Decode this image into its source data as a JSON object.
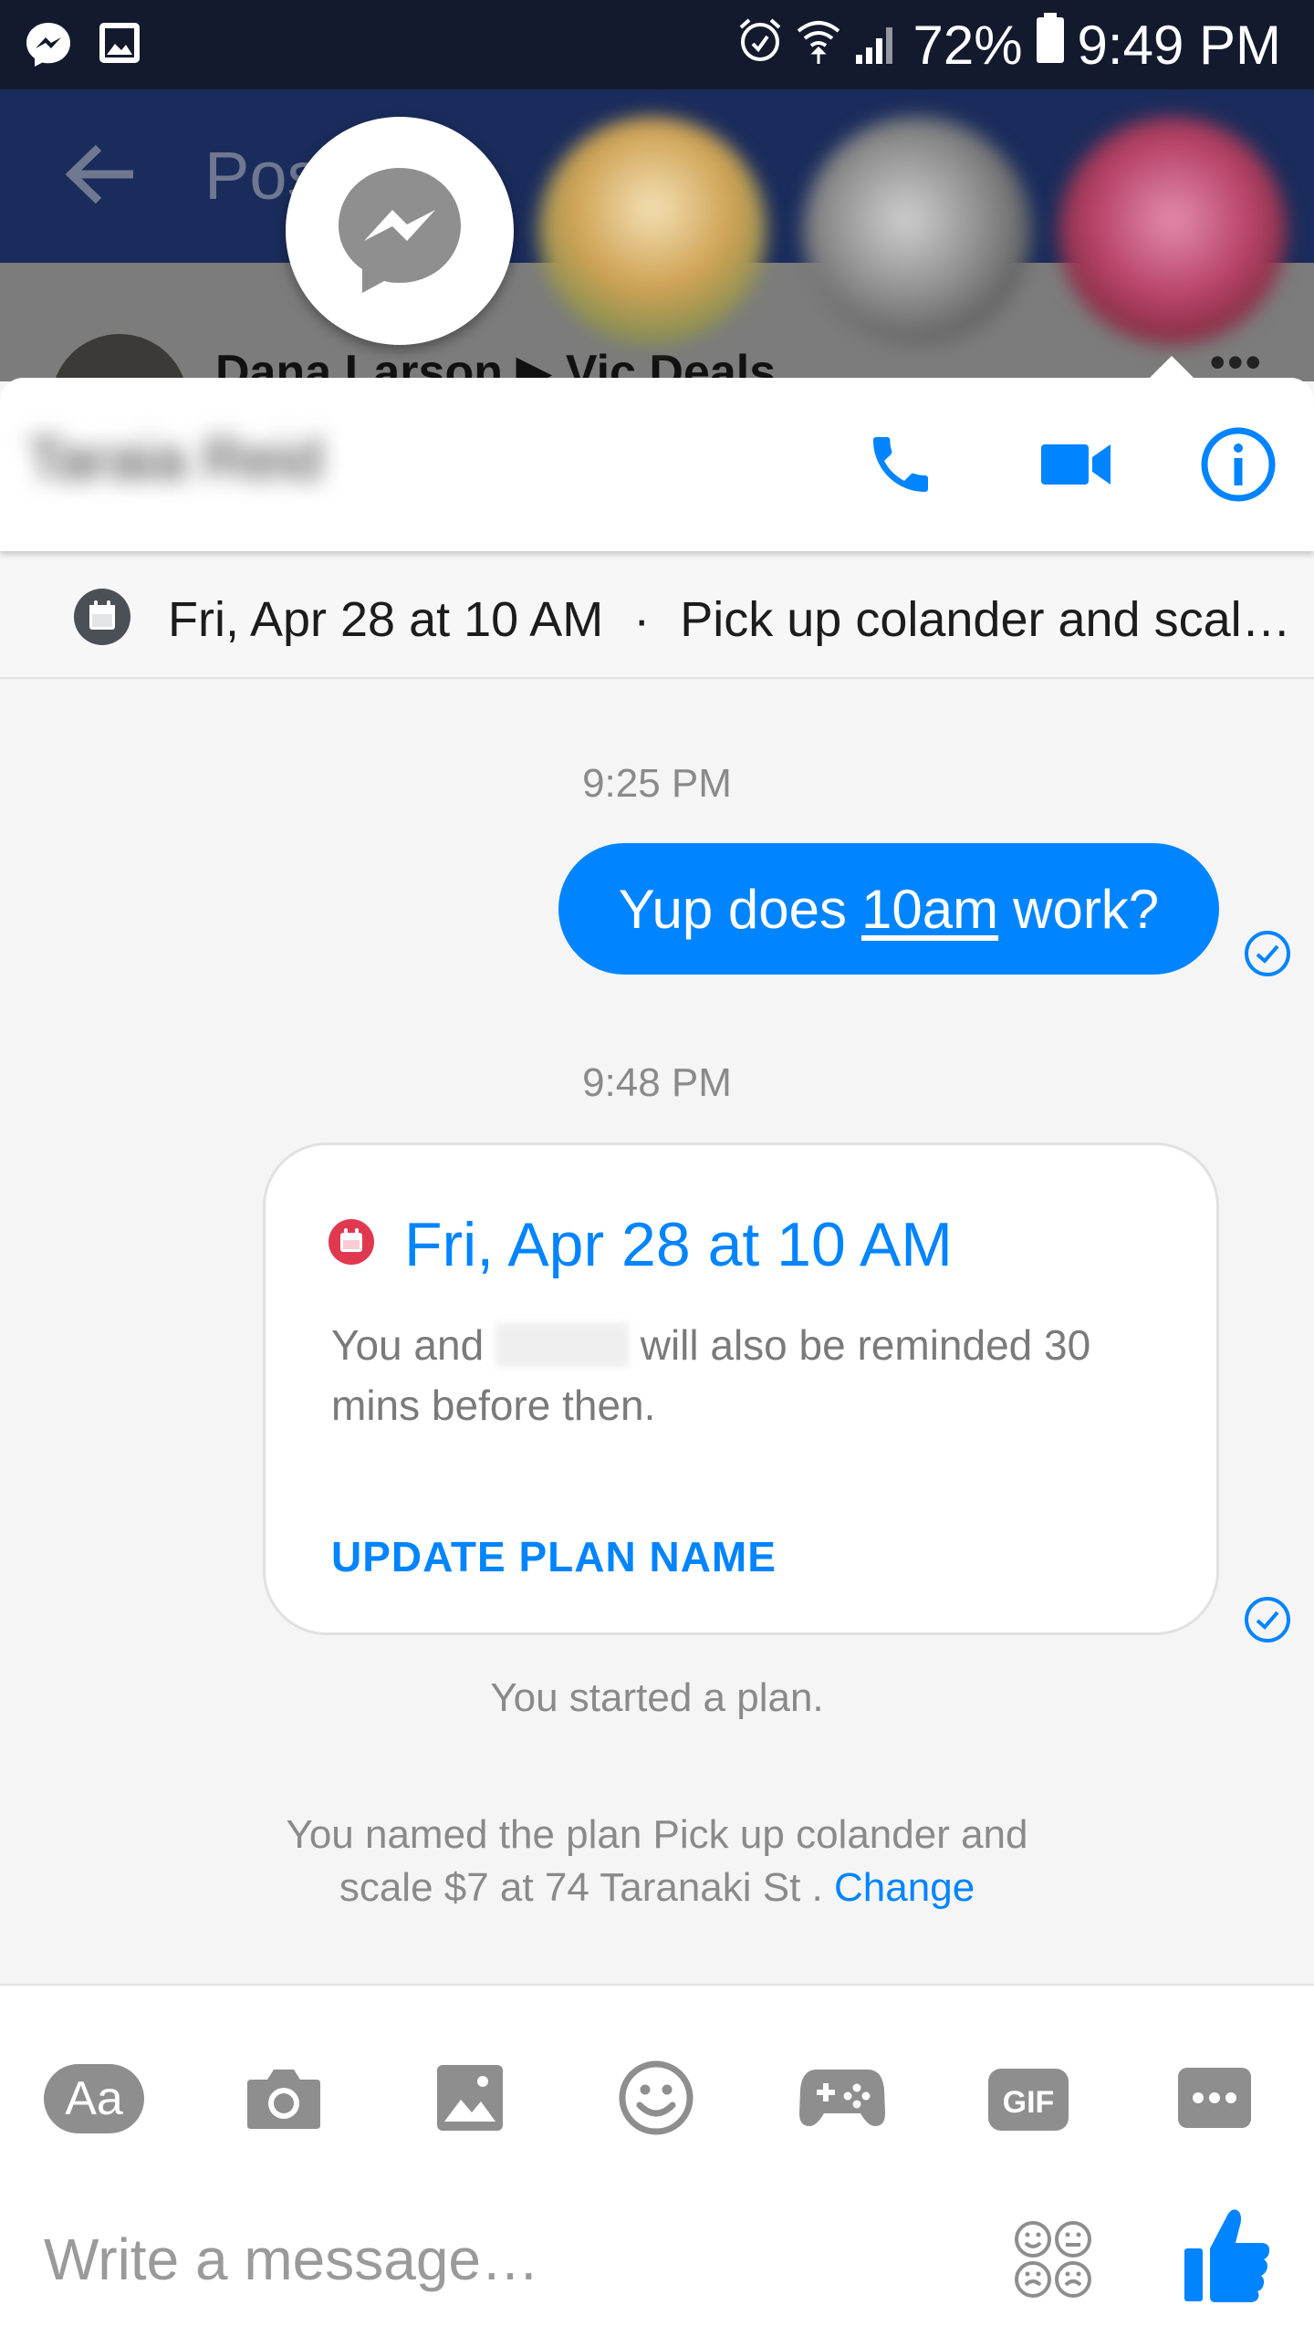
{
  "status_bar": {
    "battery": "72%",
    "time": "9:49 PM"
  },
  "background_app": {
    "title": "Pos",
    "post_author": "Dana Larson ▶ Vic Deals"
  },
  "conversation": {
    "contact_name": "Taraia Reid",
    "plan_bar": {
      "date": "Fri, Apr 28 at 10 AM",
      "separator": "·",
      "title": "Pick up colander and scale…"
    },
    "messages": {
      "time_1": "9:25 PM",
      "outgoing_prefix": "Yup does",
      "outgoing_link": "10am",
      "outgoing_suffix": "work?",
      "time_2": "9:48 PM"
    },
    "plan_card": {
      "title": "Fri, Apr 28 at 10 AM",
      "body_prefix": "You and",
      "body_suffix": "will also be reminded 30 mins before then.",
      "action": "UPDATE PLAN NAME"
    },
    "system": {
      "started": "You started a plan.",
      "named_line1": "You named the plan Pick up colander and",
      "named_line2": "scale $7 at 74 Taranaki St .",
      "change_link": "Change"
    }
  },
  "composer": {
    "aa_label": "Aa",
    "gif_label": "GIF",
    "placeholder": "Write a message…"
  },
  "colors": {
    "accent": "#0084ff",
    "status_bar": "#131a2d",
    "calendar_red": "#e0394f"
  }
}
